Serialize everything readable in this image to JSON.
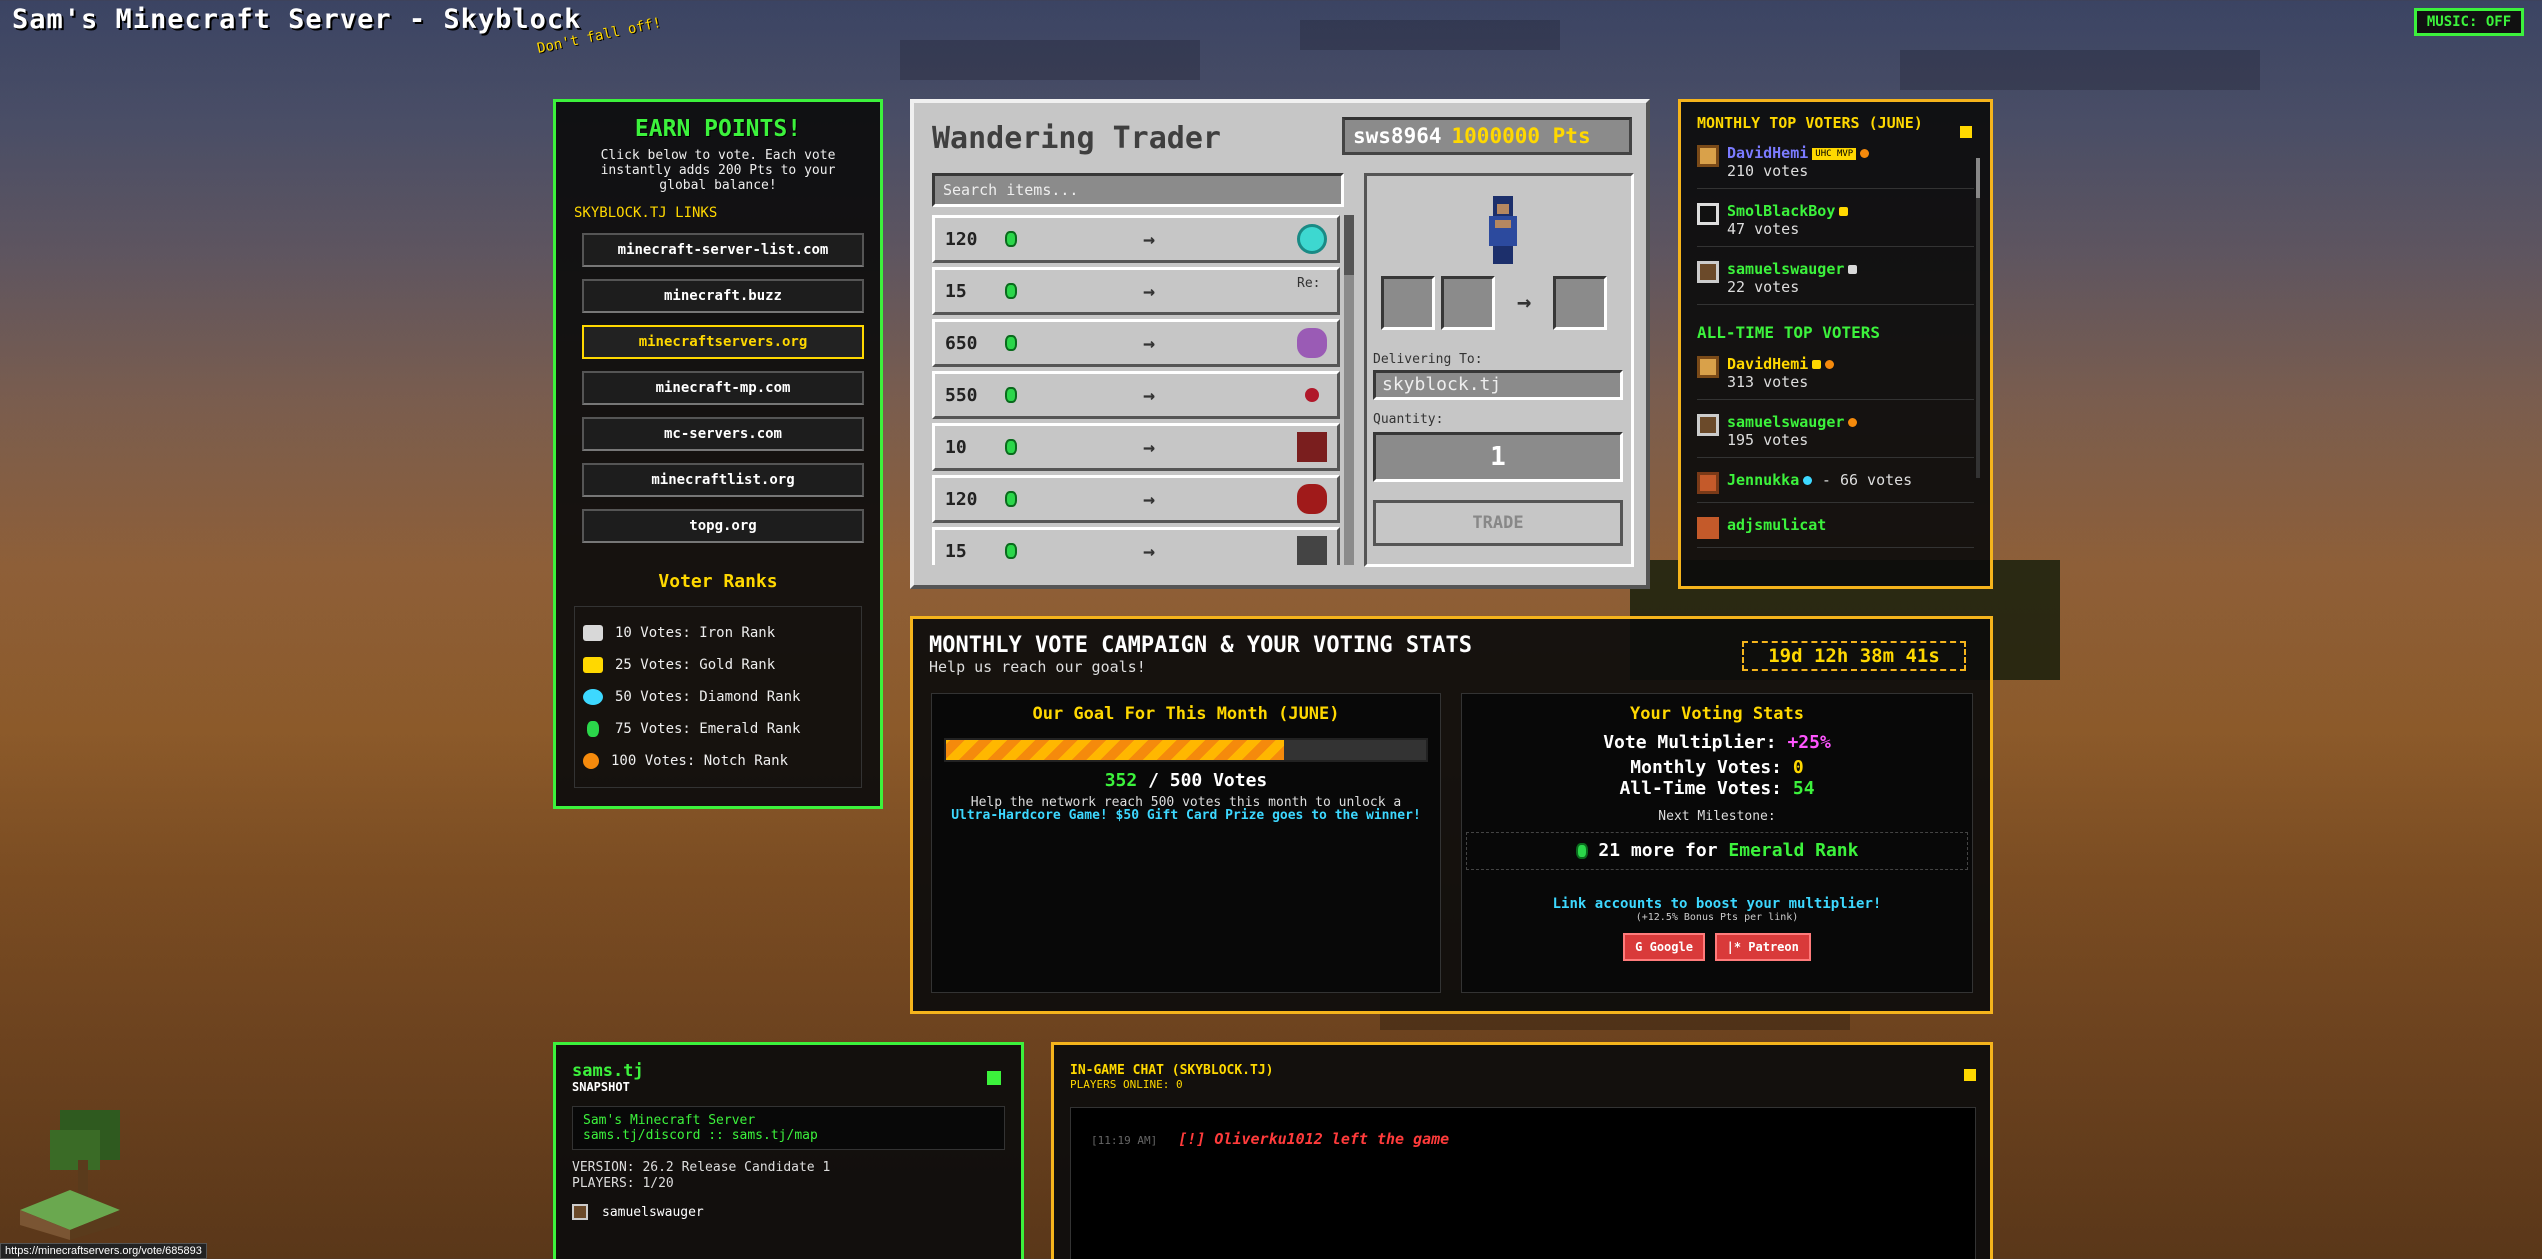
{
  "header": {
    "title": "Sam's Minecraft Server - Skyblock",
    "subtitle": "Don't fall off!",
    "music_label": "MUSIC: OFF"
  },
  "earn": {
    "heading": "EARN POINTS!",
    "description": "Click below to vote. Each vote instantly adds 200 Pts to your global balance!",
    "links_label": "SKYBLOCK.TJ LINKS",
    "links": [
      {
        "label": "minecraft-server-list.com"
      },
      {
        "label": "minecraft.buzz"
      },
      {
        "label": "minecraftservers.org"
      },
      {
        "label": "minecraft-mp.com"
      },
      {
        "label": "mc-servers.com"
      },
      {
        "label": "minecraftlist.org"
      },
      {
        "label": "topg.org"
      }
    ],
    "ranks_title": "Voter Ranks",
    "ranks": [
      {
        "label": "10 Votes: Iron Rank",
        "color": "#d8d8d8"
      },
      {
        "label": "25 Votes: Gold Rank",
        "color": "#ffd800"
      },
      {
        "label": "50 Votes: Diamond Rank",
        "color": "#3dd8ff"
      },
      {
        "label": "75 Votes: Emerald Rank",
        "color": "#2bd64a"
      },
      {
        "label": "100 Votes: Notch Rank",
        "color": "#f58a0c"
      }
    ]
  },
  "trader": {
    "title": "Wandering Trader",
    "username": "sws8964",
    "points": "1000000 Pts",
    "search_placeholder": "Search items...",
    "trades": [
      {
        "cost": "120",
        "item_color": "#3dd8d0"
      },
      {
        "cost": "15",
        "item_color": "#c6c6c6"
      },
      {
        "cost": "650",
        "item_color": "#9a5bb5"
      },
      {
        "cost": "550",
        "item_color": "#b0182a"
      },
      {
        "cost": "10",
        "item_color": "#7a1e1e"
      },
      {
        "cost": "120",
        "item_color": "#a01a1a"
      },
      {
        "cost": "15",
        "item_color": "#444"
      }
    ],
    "broken_item_text": "Re:",
    "arrow": "→",
    "delivering_label": "Delivering To:",
    "delivering_value": "skyblock.tj",
    "quantity_label": "Quantity:",
    "quantity_value": "1",
    "trade_button": "TRADE"
  },
  "voters": {
    "monthly_title": "MONTHLY TOP VOTERS (JUNE)",
    "monthly": [
      {
        "name": "DavidHemi",
        "votes": "210 votes",
        "color": "#7b7bff",
        "badge": "UHC MVP"
      },
      {
        "name": "SmolBlackBoy",
        "votes": "47 votes",
        "color": "#3cf23c"
      },
      {
        "name": "samuelswauger",
        "votes": "22 votes",
        "color": "#3cf23c"
      }
    ],
    "alltime_title": "ALL-TIME TOP VOTERS",
    "alltime": [
      {
        "name": "DavidHemi",
        "votes": "313 votes",
        "color": "#ffd800"
      },
      {
        "name": "samuelswauger",
        "votes": "195 votes",
        "color": "#3cf23c"
      },
      {
        "name": "Jennukka",
        "votes": "- 66 votes",
        "color": "#3cf23c"
      },
      {
        "name": "adjsmulicat",
        "votes": "",
        "color": "#3cf23c"
      }
    ]
  },
  "campaign": {
    "title": "MONTHLY VOTE CAMPAIGN & YOUR VOTING STATS",
    "subtitle": "Help us reach our goals!",
    "timer": "19d 12h 38m 41s",
    "goal_title": "Our Goal For This Month (JUNE)",
    "goal_current": "352",
    "goal_total": "/ 500 Votes",
    "goal_fraction": 0.704,
    "goal_desc": "Help the network reach 500 votes this month to unlock a",
    "goal_desc_highlight": "Ultra-Hardcore Game! $50 Gift Card Prize goes to the winner!",
    "stats_title": "Your Voting Stats",
    "multiplier_label": "Vote Multiplier:",
    "multiplier_value": "+25%",
    "monthly_label": "Monthly Votes:",
    "monthly_value": "0",
    "alltime_label": "All-Time Votes:",
    "alltime_value": "54",
    "next_label": "Next Milestone:",
    "milestone_prefix": "21 more for",
    "milestone_rank": "Emerald Rank",
    "boost_label": "Link accounts to boost your multiplier!",
    "boost_sub": "(+12.5% Bonus Pts per link)",
    "google_label": "G Google",
    "patreon_label": "|* Patreon"
  },
  "snapshot": {
    "name": "sams.tj",
    "sub": "SNAPSHOT",
    "motd_line1": "Sam's Minecraft Server",
    "motd_line2": "sams.tj/discord :: sams.tj/map",
    "version": "VERSION: 26.2 Release Candidate 1",
    "players": "PLAYERS: 1/20",
    "player_name": "samuelswauger"
  },
  "chat": {
    "title": "IN-GAME CHAT (SKYBLOCK.TJ)",
    "online": "PLAYERS ONLINE: 0",
    "messages": [
      {
        "time": "[11:19 AM]",
        "text": "[!] Oliverku1012 left the game"
      }
    ]
  },
  "status_bar": {
    "url": "https://minecraftservers.org/vote/685893"
  },
  "colors": {
    "green": "#3cf23c",
    "gold": "#f5b41c",
    "yellow": "#ffd800"
  }
}
